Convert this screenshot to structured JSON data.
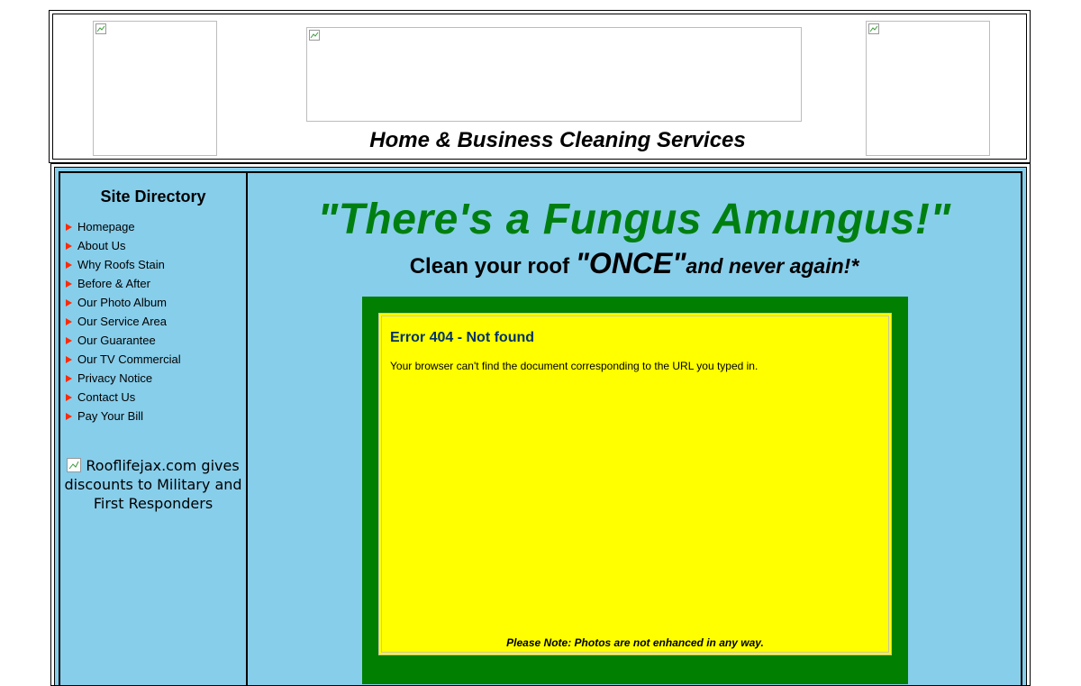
{
  "header": {
    "tagline": "Home & Business Cleaning Services"
  },
  "sidebar": {
    "title": "Site Directory",
    "items": [
      {
        "label": "Homepage"
      },
      {
        "label": "About Us"
      },
      {
        "label": "Why Roofs Stain"
      },
      {
        "label": "Before & After"
      },
      {
        "label": "Our Photo Album"
      },
      {
        "label": "Our Service Area"
      },
      {
        "label": "Our Guarantee"
      },
      {
        "label": "Our TV Commercial"
      },
      {
        "label": "Privacy Notice"
      },
      {
        "label": "Contact Us"
      },
      {
        "label": "Pay Your Bill"
      }
    ],
    "promo_alt": "Rooflifejax.com gives discounts to Military and First Responders"
  },
  "main": {
    "slogan": "\"There's a Fungus Amungus!\"",
    "sub_a": "Clean your roof ",
    "sub_b": "\"ONCE\"",
    "sub_c": "and never again!*",
    "error": {
      "title": "Error 404 - Not found",
      "message": "Your browser can't find the document corresponding to the URL you typed in."
    },
    "note": "Please Note: Photos are not enhanced in any way."
  },
  "colors": {
    "sky": "#87ceeb",
    "brand_green": "#007f10",
    "panel_green": "#007f00",
    "panel_yellow": "#ffff00",
    "arrow_red": "#ff2a00",
    "error_title": "#003366"
  },
  "icons": {
    "nav_bullet": "red-triangle-arrow",
    "broken_image": "broken-image-icon"
  }
}
